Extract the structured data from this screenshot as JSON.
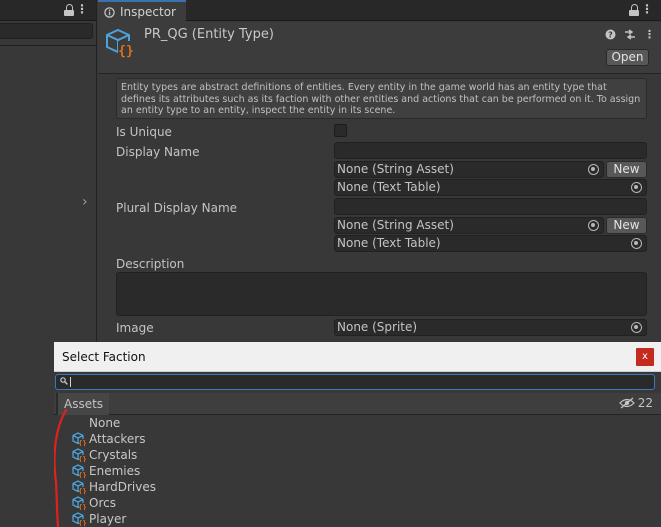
{
  "inspector": {
    "tab_label": "Inspector",
    "object_title": "PR_QG (Entity Type)",
    "open_label": "Open",
    "help_text": "Entity types are abstract definitions of entities. Every entity in the game world has an entity type that defines its attributes such as its faction with other entities and actions that can be performed on it. To assign an entity type to an entity, inspect the entity in its scene.",
    "fields": {
      "is_unique_label": "Is Unique",
      "display_name_label": "Display Name",
      "display_name_string": "None (String Asset)",
      "display_name_table": "None (Text Table)",
      "plural_label": "Plural Display Name",
      "plural_string": "None (String Asset)",
      "plural_table": "None (Text Table)",
      "description_label": "Description",
      "image_label": "Image",
      "image_value": "None (Sprite)",
      "new_label": "New"
    }
  },
  "dialog": {
    "title": "Select Faction",
    "close_label": "x",
    "assets_tab": "Assets",
    "hidden_count": "22",
    "items": [
      "None",
      "Attackers",
      "Crystals",
      "Enemies",
      "HardDrives",
      "Orcs",
      "Player"
    ]
  },
  "colors": {
    "accent": "#3a79bb",
    "icon_blue": "#4aa3df",
    "icon_orange": "#e0701c",
    "close_red": "#c42b1c",
    "annotation_red": "#e0221e"
  }
}
